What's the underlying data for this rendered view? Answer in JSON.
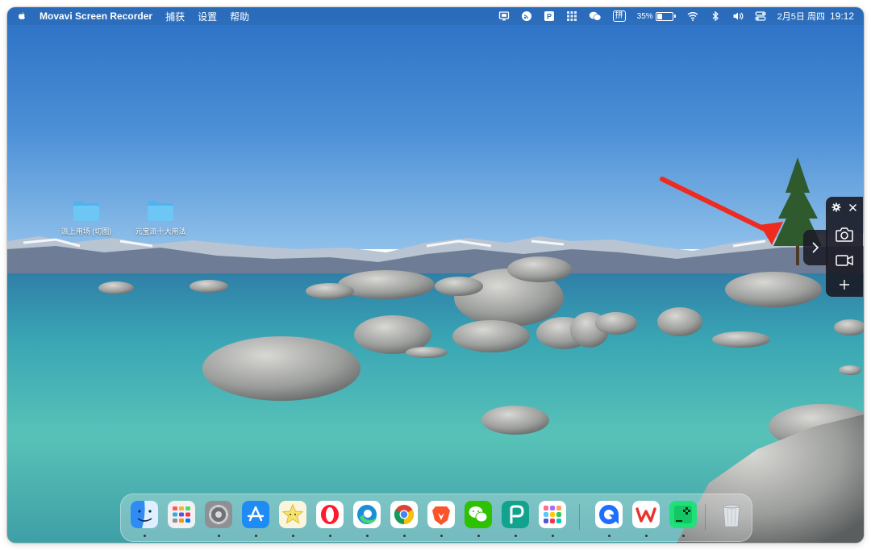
{
  "menubar": {
    "app_name": "Movavi Screen Recorder",
    "menus": [
      "捕获",
      "设置",
      "帮助"
    ],
    "battery_percent": "35%",
    "date": "2月5日 周四",
    "time": "19:12",
    "status_icons": [
      "screen-capture-icon",
      "rss-icon",
      "p-app-icon",
      "grid-icon",
      "wechat-icon",
      "pinyin-input-icon",
      "battery-icon",
      "wifi-icon",
      "bluetooth-icon",
      "volume-icon",
      "control-center-icon"
    ],
    "input_method": "拼"
  },
  "desktop": {
    "items": [
      {
        "label": "派上用场 (切图)",
        "icon": "folder-icon"
      },
      {
        "label": "元宝派十大用法",
        "icon": "folder-icon"
      }
    ]
  },
  "recorder_widget": {
    "buttons": [
      "settings-gear-icon",
      "close-icon",
      "screenshot-camera-icon",
      "video-record-icon",
      "add-icon"
    ],
    "expand": "chevron-right-icon",
    "accent": "#1b1b25"
  },
  "annotation": {
    "arrow_color": "#ef2a1f"
  },
  "dock": {
    "apps": [
      {
        "name": "Finder",
        "icon": "finder-icon",
        "running": true
      },
      {
        "name": "Launchpad",
        "icon": "launchpad-icon",
        "running": false
      },
      {
        "name": "System Settings",
        "icon": "settings-icon",
        "running": true
      },
      {
        "name": "App Store",
        "icon": "app-store-icon",
        "running": true
      },
      {
        "name": "Stickies",
        "icon": "star-app-icon",
        "running": true
      },
      {
        "name": "Opera",
        "icon": "opera-icon",
        "running": true
      },
      {
        "name": "Edge",
        "icon": "edge-icon",
        "running": true
      },
      {
        "name": "Chrome",
        "icon": "chrome-icon",
        "running": true
      },
      {
        "name": "Brave",
        "icon": "brave-icon",
        "running": true
      },
      {
        "name": "WeChat",
        "icon": "wechat-icon",
        "running": true
      },
      {
        "name": "PicGo",
        "icon": "p-app-icon",
        "running": true
      },
      {
        "name": "App Grid",
        "icon": "app-grid-icon",
        "running": true
      },
      {
        "name": "Movavi",
        "icon": "movavi-icon",
        "running": true
      },
      {
        "name": "WPS",
        "icon": "wps-icon",
        "running": true
      },
      {
        "name": "Game",
        "icon": "game-icon",
        "running": true
      },
      {
        "name": "Trash",
        "icon": "trash-icon",
        "running": false
      }
    ]
  }
}
